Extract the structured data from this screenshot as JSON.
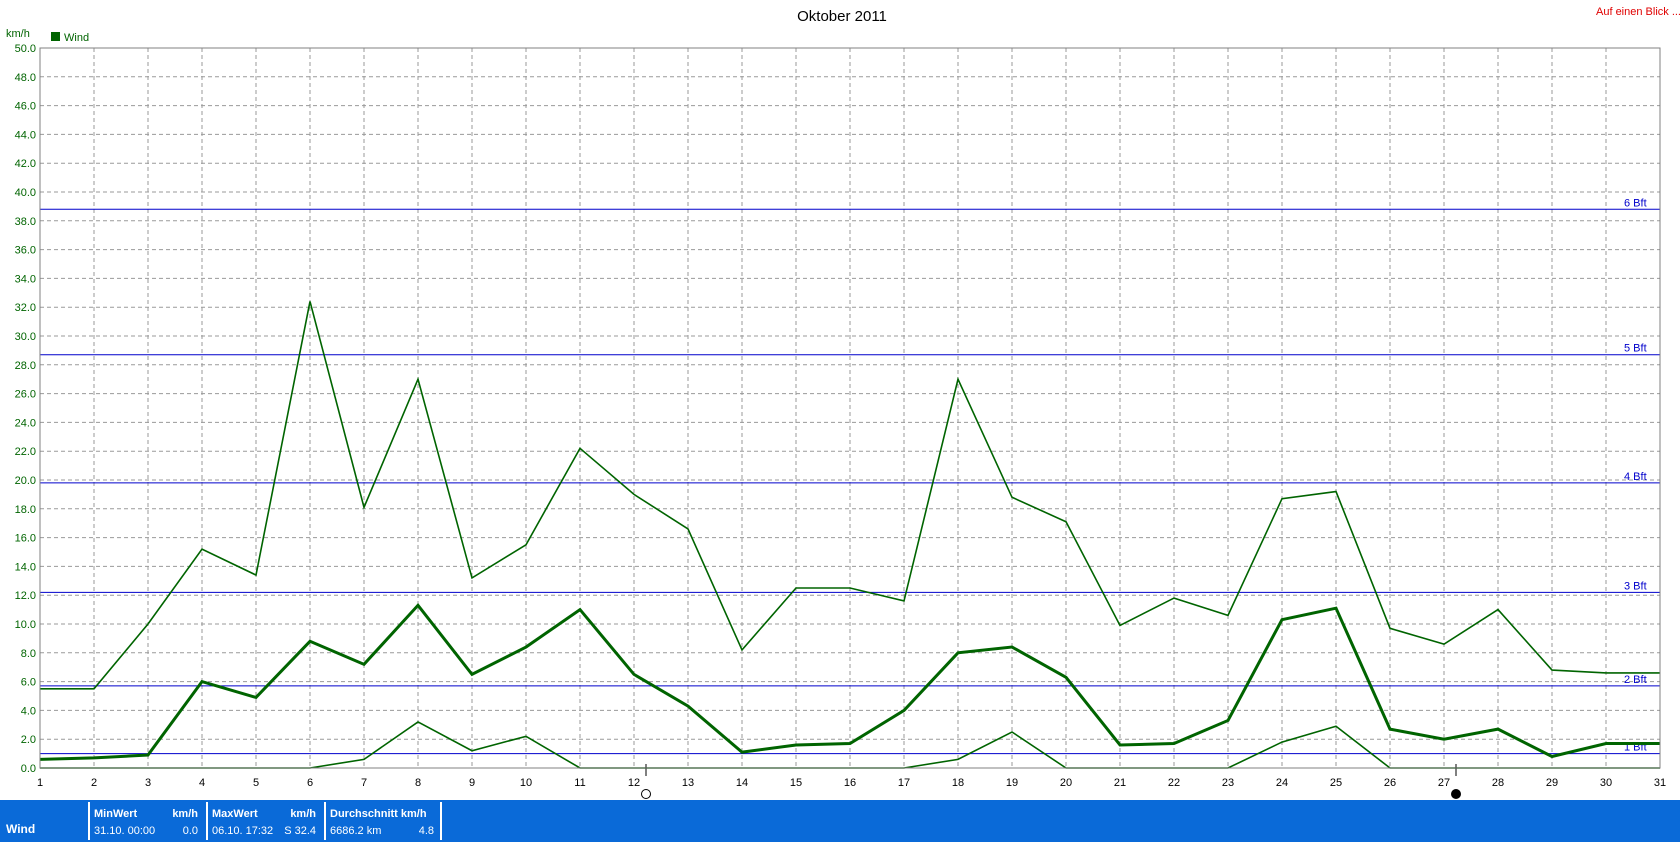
{
  "header": {
    "title": "Oktober 2011",
    "link_text": "Auf einen Blick ..."
  },
  "legend": {
    "label": "Wind",
    "color": "#006400"
  },
  "chart_data": {
    "type": "line",
    "title": "Oktober 2011",
    "ylabel": "km/h",
    "xlabel": "",
    "ylim": [
      0,
      50
    ],
    "y_ticks": [
      "0.0",
      "2.0",
      "4.0",
      "6.0",
      "8.0",
      "10.0",
      "12.0",
      "14.0",
      "16.0",
      "18.0",
      "20.0",
      "22.0",
      "24.0",
      "26.0",
      "28.0",
      "30.0",
      "32.0",
      "34.0",
      "36.0",
      "38.0",
      "40.0",
      "42.0",
      "44.0",
      "46.0",
      "48.0",
      "50.0"
    ],
    "x": [
      1,
      2,
      3,
      4,
      5,
      6,
      7,
      8,
      9,
      10,
      11,
      12,
      13,
      14,
      15,
      16,
      17,
      18,
      19,
      20,
      21,
      22,
      23,
      24,
      25,
      26,
      27,
      28,
      29,
      30,
      31
    ],
    "grid": true,
    "legend_position": "top-left",
    "series": [
      {
        "name": "Wind",
        "style": "thin",
        "color": "#006400",
        "values": [
          5.5,
          5.5,
          10.0,
          15.2,
          13.4,
          32.4,
          18.1,
          27.0,
          13.2,
          15.5,
          22.2,
          19.0,
          16.6,
          8.2,
          12.5,
          12.5,
          11.6,
          27.0,
          18.8,
          17.1,
          9.9,
          11.8,
          10.6,
          18.7,
          19.2,
          9.7,
          8.6,
          11.0,
          6.8,
          6.6,
          6.6
        ]
      },
      {
        "name": "",
        "style": "thick",
        "color": "#006400",
        "values": [
          0.6,
          0.7,
          0.9,
          6.0,
          4.9,
          8.8,
          7.2,
          11.3,
          6.5,
          8.4,
          11.0,
          6.5,
          4.3,
          1.1,
          1.6,
          1.7,
          4.0,
          8.0,
          8.4,
          6.3,
          1.6,
          1.7,
          3.3,
          10.3,
          11.1,
          2.7,
          2.0,
          2.7,
          0.8,
          1.7,
          1.7
        ]
      },
      {
        "name": "",
        "style": "thin",
        "color": "#006400",
        "values": [
          0.0,
          0.0,
          0.0,
          0.0,
          0.0,
          0.0,
          0.6,
          3.2,
          1.2,
          2.2,
          0.0,
          0.0,
          0.0,
          0.0,
          0.0,
          0.0,
          0.0,
          0.6,
          2.5,
          0.0,
          0.0,
          0.0,
          0.0,
          1.8,
          2.9,
          0.0,
          0.0,
          0.0,
          0.0,
          0.0,
          0.0
        ]
      }
    ],
    "beaufort_lines": [
      {
        "label": "1 Bft",
        "value": 1.0
      },
      {
        "label": "2 Bft",
        "value": 5.7
      },
      {
        "label": "3 Bft",
        "value": 12.2
      },
      {
        "label": "4 Bft",
        "value": 19.8
      },
      {
        "label": "5 Bft",
        "value": 28.7
      },
      {
        "label": "6 Bft",
        "value": 38.8
      }
    ],
    "moon_markers": [
      {
        "day": 12,
        "phase": "full-moon"
      },
      {
        "day": 27,
        "phase": "new-moon"
      }
    ]
  },
  "stats": {
    "row_label": "Wind",
    "min": {
      "header": "MinWert",
      "unit": "km/h",
      "datetime": "31.10.  00:00",
      "value": "0.0"
    },
    "max": {
      "header": "MaxWert",
      "unit": "km/h",
      "datetime": "06.10.  17:32",
      "value": "S 32.4"
    },
    "avg": {
      "header": "Durchschnitt km/h",
      "distance": "6686.2 km",
      "value": "4.8"
    }
  }
}
